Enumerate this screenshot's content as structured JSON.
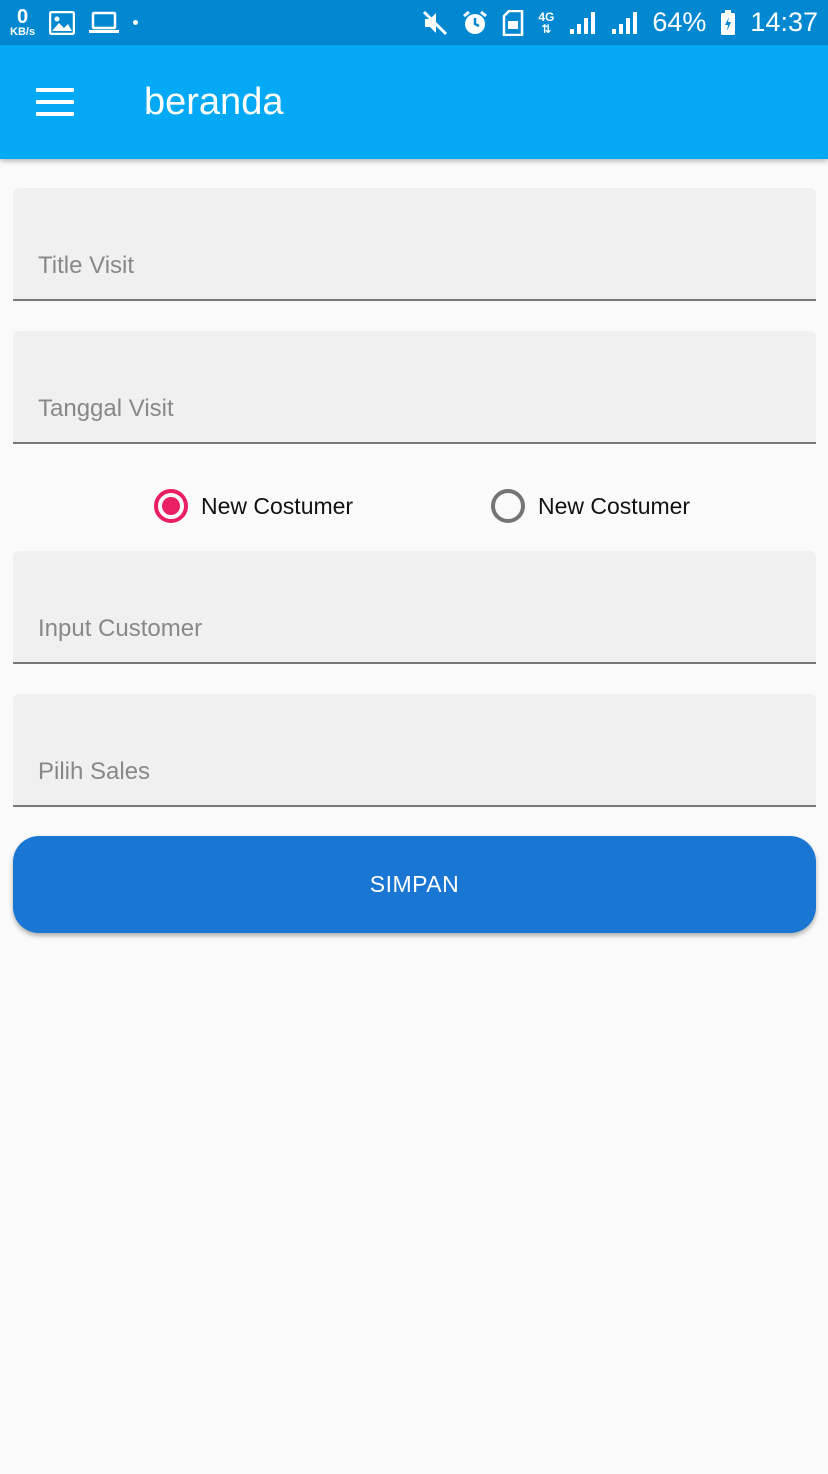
{
  "status_bar": {
    "net_speed_value": "0",
    "net_speed_unit": "KB/s",
    "network_type": "4G",
    "battery": "64%",
    "time": "14:37",
    "icons": [
      "image-icon",
      "laptop-icon",
      "dot-icon",
      "mute-icon",
      "alarm-icon",
      "sim-icon",
      "signal-icon",
      "signal-icon",
      "battery-icon"
    ]
  },
  "app_bar": {
    "title": "beranda",
    "menu_icon": "hamburger-menu-icon",
    "color": "#03a9f4"
  },
  "form": {
    "title_visit": {
      "placeholder": "Title Visit",
      "value": ""
    },
    "tanggal_visit": {
      "placeholder": "Tanggal Visit",
      "value": ""
    },
    "radio_options": [
      {
        "label": "New Costumer",
        "checked": true
      },
      {
        "label": "New Costumer",
        "checked": false
      }
    ],
    "input_customer": {
      "placeholder": "Input Customer",
      "value": ""
    },
    "pilih_sales": {
      "placeholder": "Pilih Sales",
      "value": ""
    },
    "save_label": "SIMPAN"
  },
  "colors": {
    "status_bar": "#0288d1",
    "accent": "#e91e63",
    "button": "#1976d2",
    "background": "#fafafa"
  }
}
